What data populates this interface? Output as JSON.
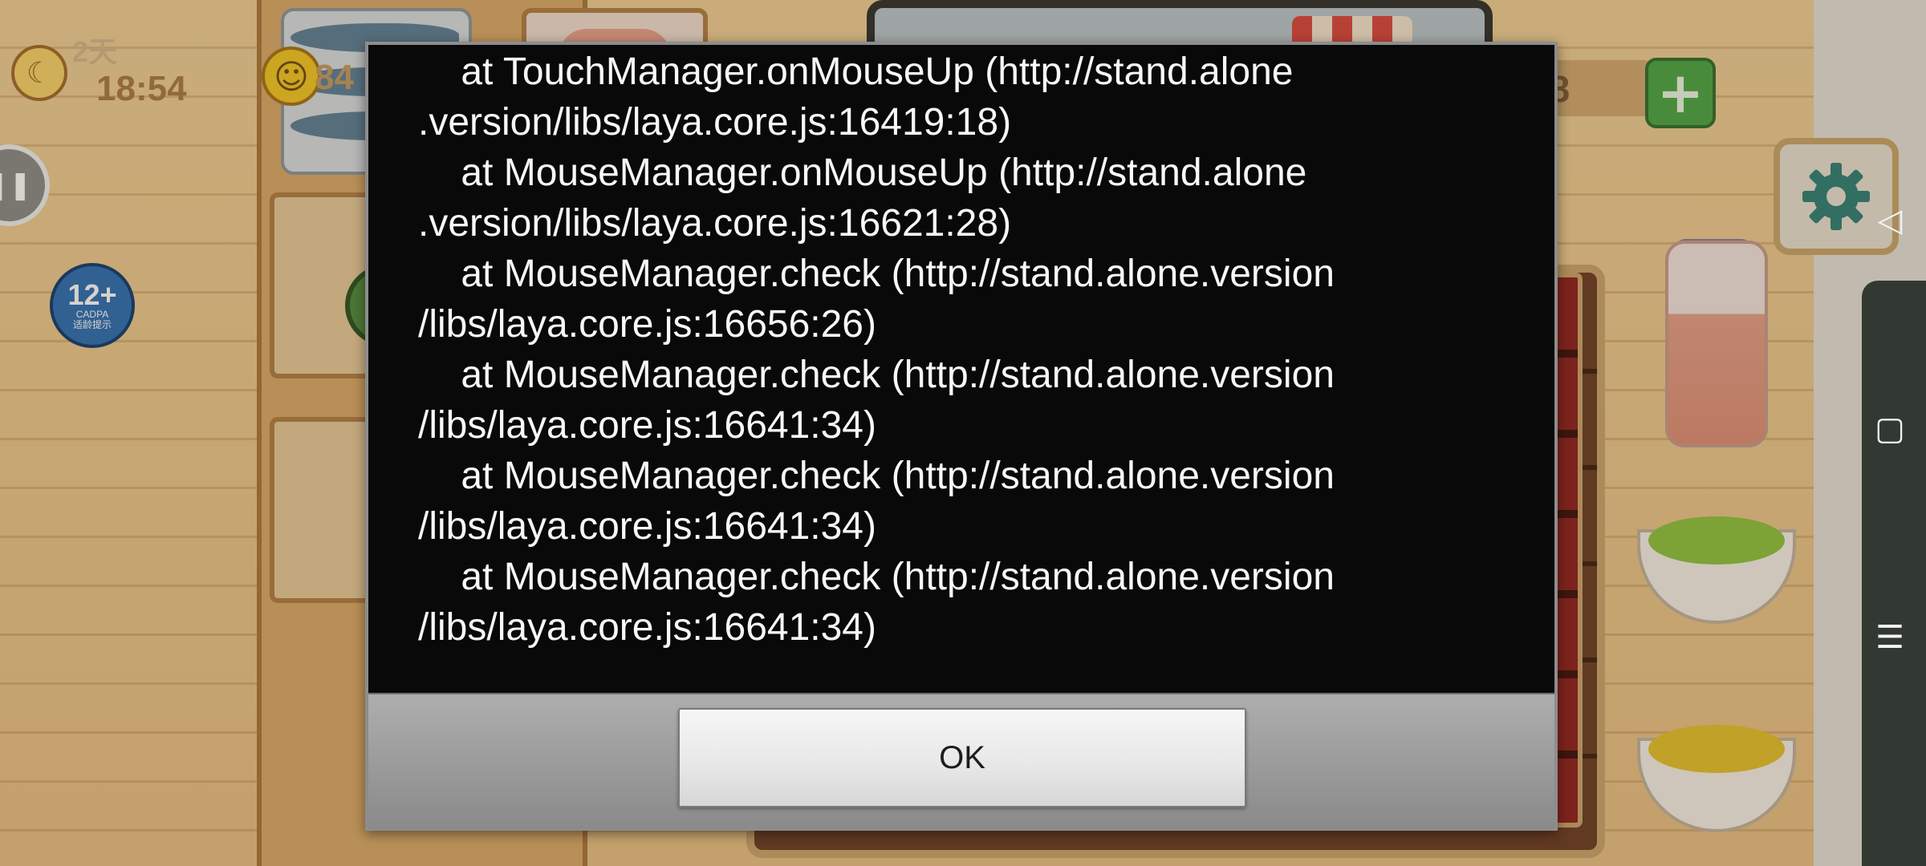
{
  "hud": {
    "day_label": "2天",
    "time": "18:54",
    "score_partial": "84",
    "money_partial": "48",
    "plus_glyph": "+",
    "pause_glyph": "❚❚",
    "moon_glyph": "☾",
    "smiley_glyph": "☺"
  },
  "age_badge": {
    "rating": "12+",
    "org": "CADPA",
    "caption": "适龄提示"
  },
  "system_nav": {
    "back_glyph": "◁",
    "home_glyph": "▢",
    "menu_glyph": "☰"
  },
  "dialog": {
    "trace_lines": [
      "    at TouchManager.onMouseUp (http://stand.alone",
      ".version/libs/laya.core.js:16419:18)",
      "    at MouseManager.onMouseUp (http://stand.alone",
      ".version/libs/laya.core.js:16621:28)",
      "    at MouseManager.check (http://stand.alone.version",
      "/libs/laya.core.js:16656:26)",
      "    at MouseManager.check (http://stand.alone.version",
      "/libs/laya.core.js:16641:34)",
      "    at MouseManager.check (http://stand.alone.version",
      "/libs/laya.core.js:16641:34)",
      "    at MouseManager.check (http://stand.alone.version",
      "/libs/laya.core.js:16641:34)"
    ],
    "ok_label": "OK"
  },
  "colors": {
    "dialog_bg": "#090909",
    "dialog_text": "#f7f7f7",
    "footer_bg": "#9a9a9a",
    "button_bg": "#e7e7e7",
    "button_text": "#1d1d1d"
  }
}
